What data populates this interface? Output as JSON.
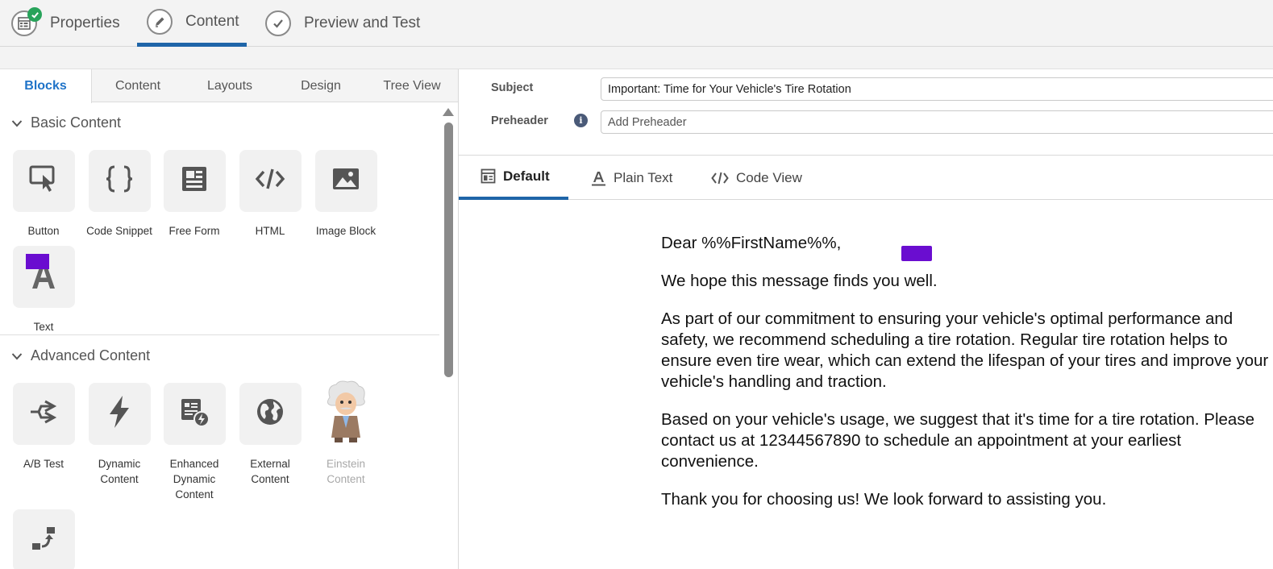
{
  "wizard": {
    "steps": [
      {
        "label": "Properties",
        "icon": "properties-icon",
        "state": "completed"
      },
      {
        "label": "Content",
        "icon": "pencil-icon",
        "state": "active"
      },
      {
        "label": "Preview and Test",
        "icon": "checkmark-icon",
        "state": "pending"
      }
    ],
    "accent_color": "#1f65a8",
    "complete_color": "#27a35a"
  },
  "left_tabs": [
    "Blocks",
    "Content",
    "Layouts",
    "Design",
    "Tree View"
  ],
  "basic_content": {
    "title": "Basic Content",
    "blocks": [
      {
        "label": "Button",
        "icon": "button-click-icon"
      },
      {
        "label": "Code Snippet",
        "icon": "curly-braces-icon"
      },
      {
        "label": "Free Form",
        "icon": "free-form-icon"
      },
      {
        "label": "HTML",
        "icon": "code-tag-icon"
      },
      {
        "label": "Image Block",
        "icon": "image-icon"
      },
      {
        "label": "Text",
        "icon": "text-a-icon"
      }
    ]
  },
  "advanced_content": {
    "title": "Advanced Content",
    "blocks": [
      {
        "label": "A/B Test",
        "icon": "ab-test-icon"
      },
      {
        "label": "Dynamic Content",
        "icon": "lightning-icon"
      },
      {
        "label": "Enhanced Dynamic Content",
        "icon": "enhanced-dynamic-icon"
      },
      {
        "label": "External Content",
        "icon": "globe-icon"
      },
      {
        "label": "Einstein Content",
        "icon": "einstein-icon",
        "disabled": true
      },
      {
        "label": "",
        "icon": "move-blocks-icon"
      }
    ]
  },
  "subject": {
    "label": "Subject",
    "value": "Important: Time for Your Vehicle's Tire Rotation"
  },
  "preheader": {
    "label": "Preheader",
    "placeholder": "Add Preheader",
    "info_glyph": "i"
  },
  "view_tabs": [
    {
      "label": "Default",
      "icon": "layout-icon"
    },
    {
      "label": "Plain Text",
      "icon": "text-underline-icon"
    },
    {
      "label": "Code View",
      "icon": "code-view-icon"
    }
  ],
  "email": {
    "greeting": "Dear %%FirstName%%,",
    "paragraphs": [
      "We hope this message finds you well.",
      "As part of our commitment to ensuring your vehicle's optimal performance and safety, we recommend scheduling a tire rotation. Regular tire rotation helps to ensure even tire wear, which can extend the lifespan of your tires and improve your vehicle's handling and traction.",
      "Based on your vehicle's usage, we suggest that it's time for a tire rotation. Please contact us at 12344567890 to schedule an appointment at your earliest convenience.",
      "Thank you for choosing us! We look forward to assisting you."
    ]
  },
  "redaction_color": "#6a0dd0"
}
